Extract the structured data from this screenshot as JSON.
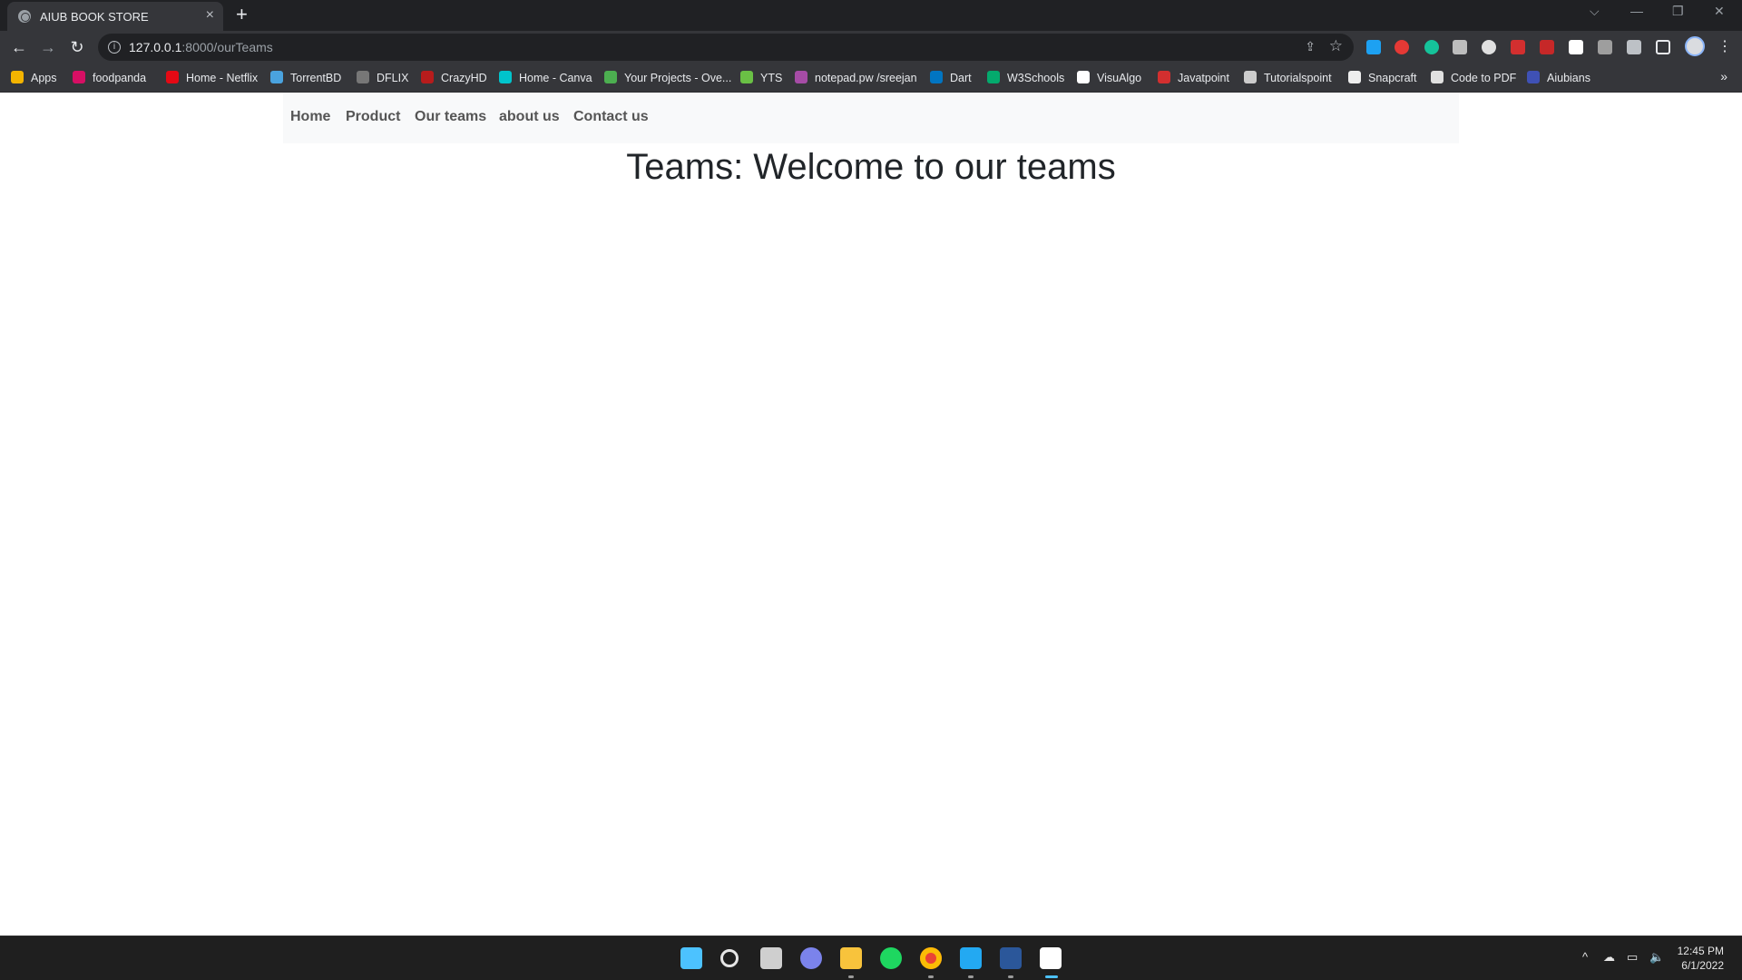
{
  "browser": {
    "tab": {
      "title": "AIUB BOOK STORE",
      "close": "×"
    },
    "new_tab": "+",
    "window_controls": {
      "tab_search": "⌵",
      "minimize": "—",
      "restore": "❐",
      "close": "✕"
    },
    "nav": {
      "back": "←",
      "forward": "→",
      "reload": "↻"
    },
    "address": {
      "host": "127.0.0.1",
      "rest": ":8000/ourTeams"
    },
    "bookmarks": [
      {
        "label": "Apps",
        "color": "#f4b400"
      },
      {
        "label": "foodpanda",
        "color": "#d70f64"
      },
      {
        "label": "Home - Netflix",
        "color": "#e50914"
      },
      {
        "label": "TorrentBD",
        "color": "#4aa3df"
      },
      {
        "label": "DFLIX",
        "color": "#777777"
      },
      {
        "label": "CrazyHD",
        "color": "#b71c1c"
      },
      {
        "label": "Home - Canva",
        "color": "#00c4cc"
      },
      {
        "label": "Your Projects - Ove...",
        "color": "#4caf50"
      },
      {
        "label": "YTS",
        "color": "#6ac045"
      },
      {
        "label": "notepad.pw /sreejan",
        "color": "#a64ca6"
      },
      {
        "label": "Dart",
        "color": "#0175c2"
      },
      {
        "label": "W3Schools",
        "color": "#04aa6d"
      },
      {
        "label": "VisuAlgo",
        "color": "#ffffff"
      },
      {
        "label": "Javatpoint",
        "color": "#d32f2f"
      },
      {
        "label": "Tutorialspoint",
        "color": "#cccccc"
      },
      {
        "label": "Snapcraft",
        "color": "#eeeeee"
      },
      {
        "label": "Code to PDF",
        "color": "#e0e0e0"
      },
      {
        "label": "Aiubians",
        "color": "#3f51b5"
      }
    ],
    "bookmarks_more": "»"
  },
  "site": {
    "nav": [
      "Home",
      "Product",
      "Our teams",
      "about us",
      "Contact us"
    ],
    "heading": "Teams: Welcome to our teams"
  },
  "taskbar": {
    "clock_time": "12:45 PM",
    "clock_date": "6/1/2022"
  }
}
